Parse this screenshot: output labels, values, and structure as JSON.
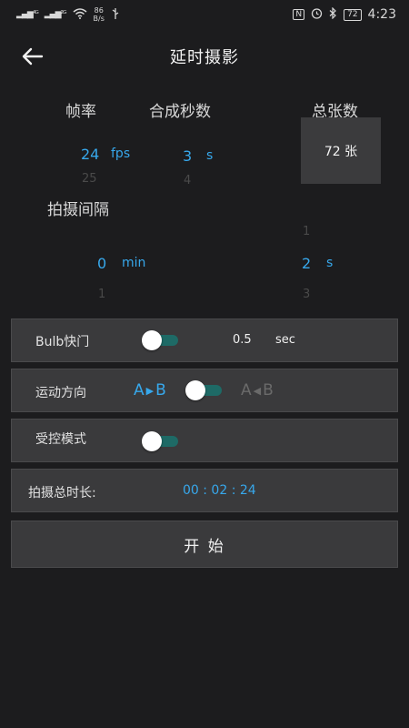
{
  "status_bar": {
    "signal1": "⁴ᴳ",
    "signal2": "²ᴳ",
    "net_speed_value": "86",
    "net_speed_unit": "B/s",
    "nfc": "N",
    "battery": "72",
    "time": "4:23"
  },
  "app_bar": {
    "title": "延时摄影"
  },
  "settings": {
    "frame_rate": {
      "label": "帧率",
      "value": "24",
      "unit": "fps",
      "next": "25"
    },
    "synth_seconds": {
      "label": "合成秒数",
      "value": "3",
      "unit": "s",
      "next": "4"
    },
    "total_frames": {
      "label": "总张数",
      "value": "72 张"
    },
    "interval": {
      "label": "拍摄间隔",
      "min_value": "0",
      "min_unit": "min",
      "min_next": "1",
      "sec_prev": "1",
      "sec_value": "2",
      "sec_unit": "s",
      "sec_next": "3"
    }
  },
  "bulb": {
    "label": "Bulb快门",
    "value": "0.5",
    "unit": "sec"
  },
  "motion": {
    "label": "运动方向",
    "ab_left": "A",
    "ab_right": "B",
    "ba_left": "A",
    "ba_right": "B"
  },
  "controlled": {
    "label": "受控模式"
  },
  "duration": {
    "label": "拍摄总时长:",
    "value": "00 : 02 : 24"
  },
  "start_button": {
    "label": "开 始"
  },
  "colors": {
    "accent": "#37a8ec",
    "row_bg": "#3a3a3c",
    "bg": "#1c1c1e"
  }
}
